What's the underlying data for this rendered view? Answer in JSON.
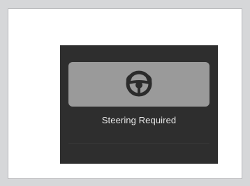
{
  "alert": {
    "message": "Steering Required",
    "icon": "steering-wheel-hands-icon"
  },
  "colors": {
    "page_bg": "#d6d7d9",
    "frame_bg": "#ffffff",
    "display_bg": "#2e2e2e",
    "panel_bg": "#9a9a9a",
    "icon_color": "#2b2b2b",
    "text_color": "#e9e9e9"
  }
}
